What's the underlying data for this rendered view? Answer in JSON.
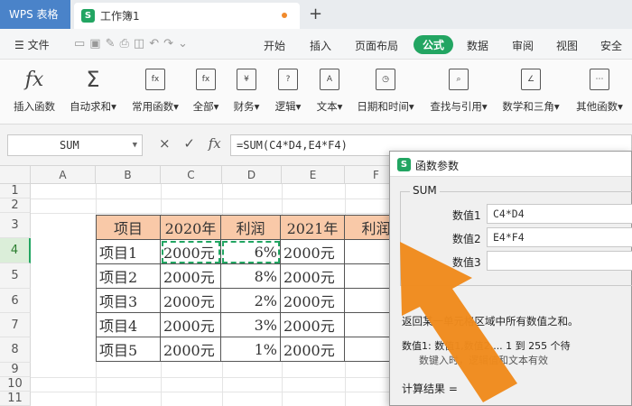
{
  "app": {
    "name": "WPS 表格",
    "doc_title": "工作簿1",
    "doc_icon": "S",
    "add_tab": "+"
  },
  "menu": {
    "file_label": "文件",
    "tabs": [
      {
        "label": "开始"
      },
      {
        "label": "插入"
      },
      {
        "label": "页面布局"
      },
      {
        "label": "公式",
        "active": true
      },
      {
        "label": "数据"
      },
      {
        "label": "审阅"
      },
      {
        "label": "视图"
      },
      {
        "label": "安全"
      }
    ]
  },
  "ribbon": {
    "buttons": [
      {
        "label": "插入函数",
        "icon": "fx-icon",
        "glyph": "fx"
      },
      {
        "label": "自动求和",
        "icon": "sigma-icon",
        "glyph": "Σ",
        "dropdown": true
      },
      {
        "label": "常用函数",
        "icon": "star-function-icon",
        "glyph": "fx",
        "dropdown": true
      },
      {
        "label": "全部",
        "icon": "all-functions-icon",
        "glyph": "fx",
        "dropdown": true
      },
      {
        "label": "财务",
        "icon": "finance-icon",
        "glyph": "¥",
        "dropdown": true
      },
      {
        "label": "逻辑",
        "icon": "logic-icon",
        "glyph": "?",
        "dropdown": true
      },
      {
        "label": "文本",
        "icon": "text-icon",
        "glyph": "A",
        "dropdown": true
      },
      {
        "label": "日期和时间",
        "icon": "clock-icon",
        "glyph": "◷",
        "dropdown": true
      },
      {
        "label": "查找与引用",
        "icon": "lookup-icon",
        "glyph": "⌕",
        "dropdown": true
      },
      {
        "label": "数学和三角",
        "icon": "math-icon",
        "glyph": "∠",
        "dropdown": true
      },
      {
        "label": "其他函数",
        "icon": "more-functions-icon",
        "glyph": "⋯",
        "dropdown": true
      }
    ]
  },
  "formula_bar": {
    "name_box": "SUM",
    "formula": "=SUM(C4*D4,E4*F4)",
    "cancel_icon": "×",
    "confirm_icon": "✓",
    "fx_icon": "fx"
  },
  "grid": {
    "columns": [
      "A",
      "B",
      "C",
      "D",
      "E",
      "F"
    ],
    "rows": [
      "1",
      "2",
      "3",
      "4",
      "5",
      "6",
      "7",
      "8",
      "9",
      "10",
      "11"
    ],
    "selected_row": "4",
    "table": {
      "headers": [
        "项目",
        "2020年",
        "利润",
        "2021年",
        "利润"
      ],
      "rows": [
        [
          "项目1",
          "2000元",
          "6%",
          "2000元",
          ""
        ],
        [
          "项目2",
          "2000元",
          "8%",
          "2000元",
          ""
        ],
        [
          "项目3",
          "2000元",
          "2%",
          "2000元",
          ""
        ],
        [
          "项目4",
          "2000元",
          "3%",
          "2000元",
          ""
        ],
        [
          "项目5",
          "2000元",
          "1%",
          "2000元",
          ""
        ]
      ]
    }
  },
  "dialog": {
    "title": "函数参数",
    "function_name": "SUM",
    "args": [
      {
        "label": "数值1",
        "value": "C4*D4"
      },
      {
        "label": "数值2",
        "value": "E4*F4"
      },
      {
        "label": "数值3",
        "value": ""
      }
    ],
    "description": "返回某一单元格区域中所有数值之和。",
    "args_help": "数值1:  数值1,数值2,... 1 到 255 个待",
    "args_help2": "数键入时，逻辑值和文本有效",
    "result_label": "计算结果 ="
  },
  "colors": {
    "accent": "#22a562",
    "header_fill": "#f9c9a8",
    "arrow": "#f08a1c",
    "app_tab": "#4a83c9"
  }
}
